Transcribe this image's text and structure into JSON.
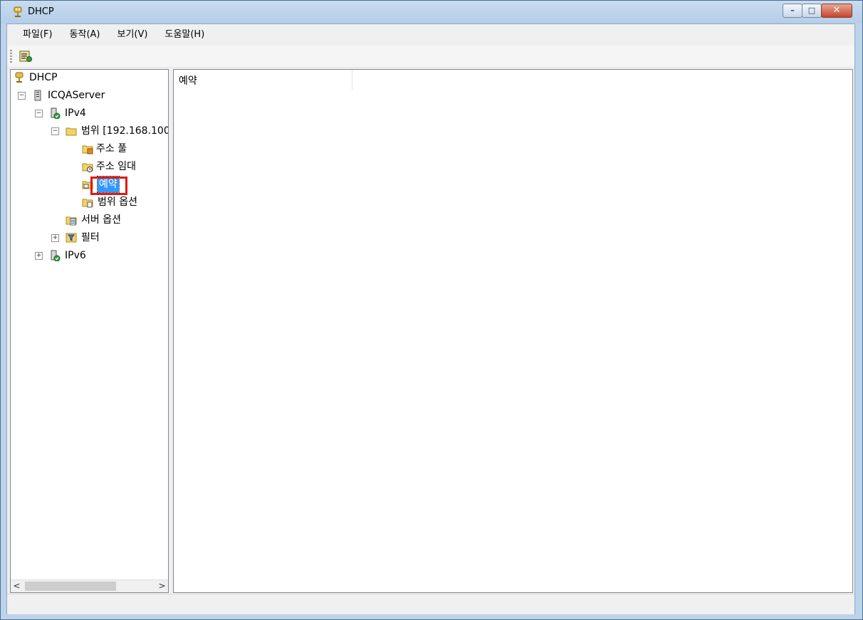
{
  "window": {
    "title": "DHCP",
    "minimize": "–",
    "maximize": "□",
    "close": "✕"
  },
  "menu": [
    {
      "label": "파일(F)"
    },
    {
      "label": "동작(A)"
    },
    {
      "label": "보기(V)"
    },
    {
      "label": "도움말(H)"
    }
  ],
  "toolbar": {
    "buttons": [
      {
        "icon": "properties-icon"
      }
    ]
  },
  "tree": {
    "root": "DHCP",
    "server": "ICQAServer",
    "ipv4": "IPv4",
    "scope": "범위 [192.168.100",
    "address_pool": "주소 풀",
    "address_leases": "주소 임대",
    "reservations": "예약",
    "scope_options": "범위 옵션",
    "server_options": "서버 옵션",
    "filters": "필터",
    "ipv6": "IPv6",
    "selected": "예약"
  },
  "scrollbar": {
    "left_arrow": "<",
    "right_arrow": ">"
  },
  "detail": {
    "column_header": "예약"
  },
  "colors": {
    "selection": "#3399ff",
    "highlight_box": "#e01818",
    "close_button": "#c4452f"
  }
}
